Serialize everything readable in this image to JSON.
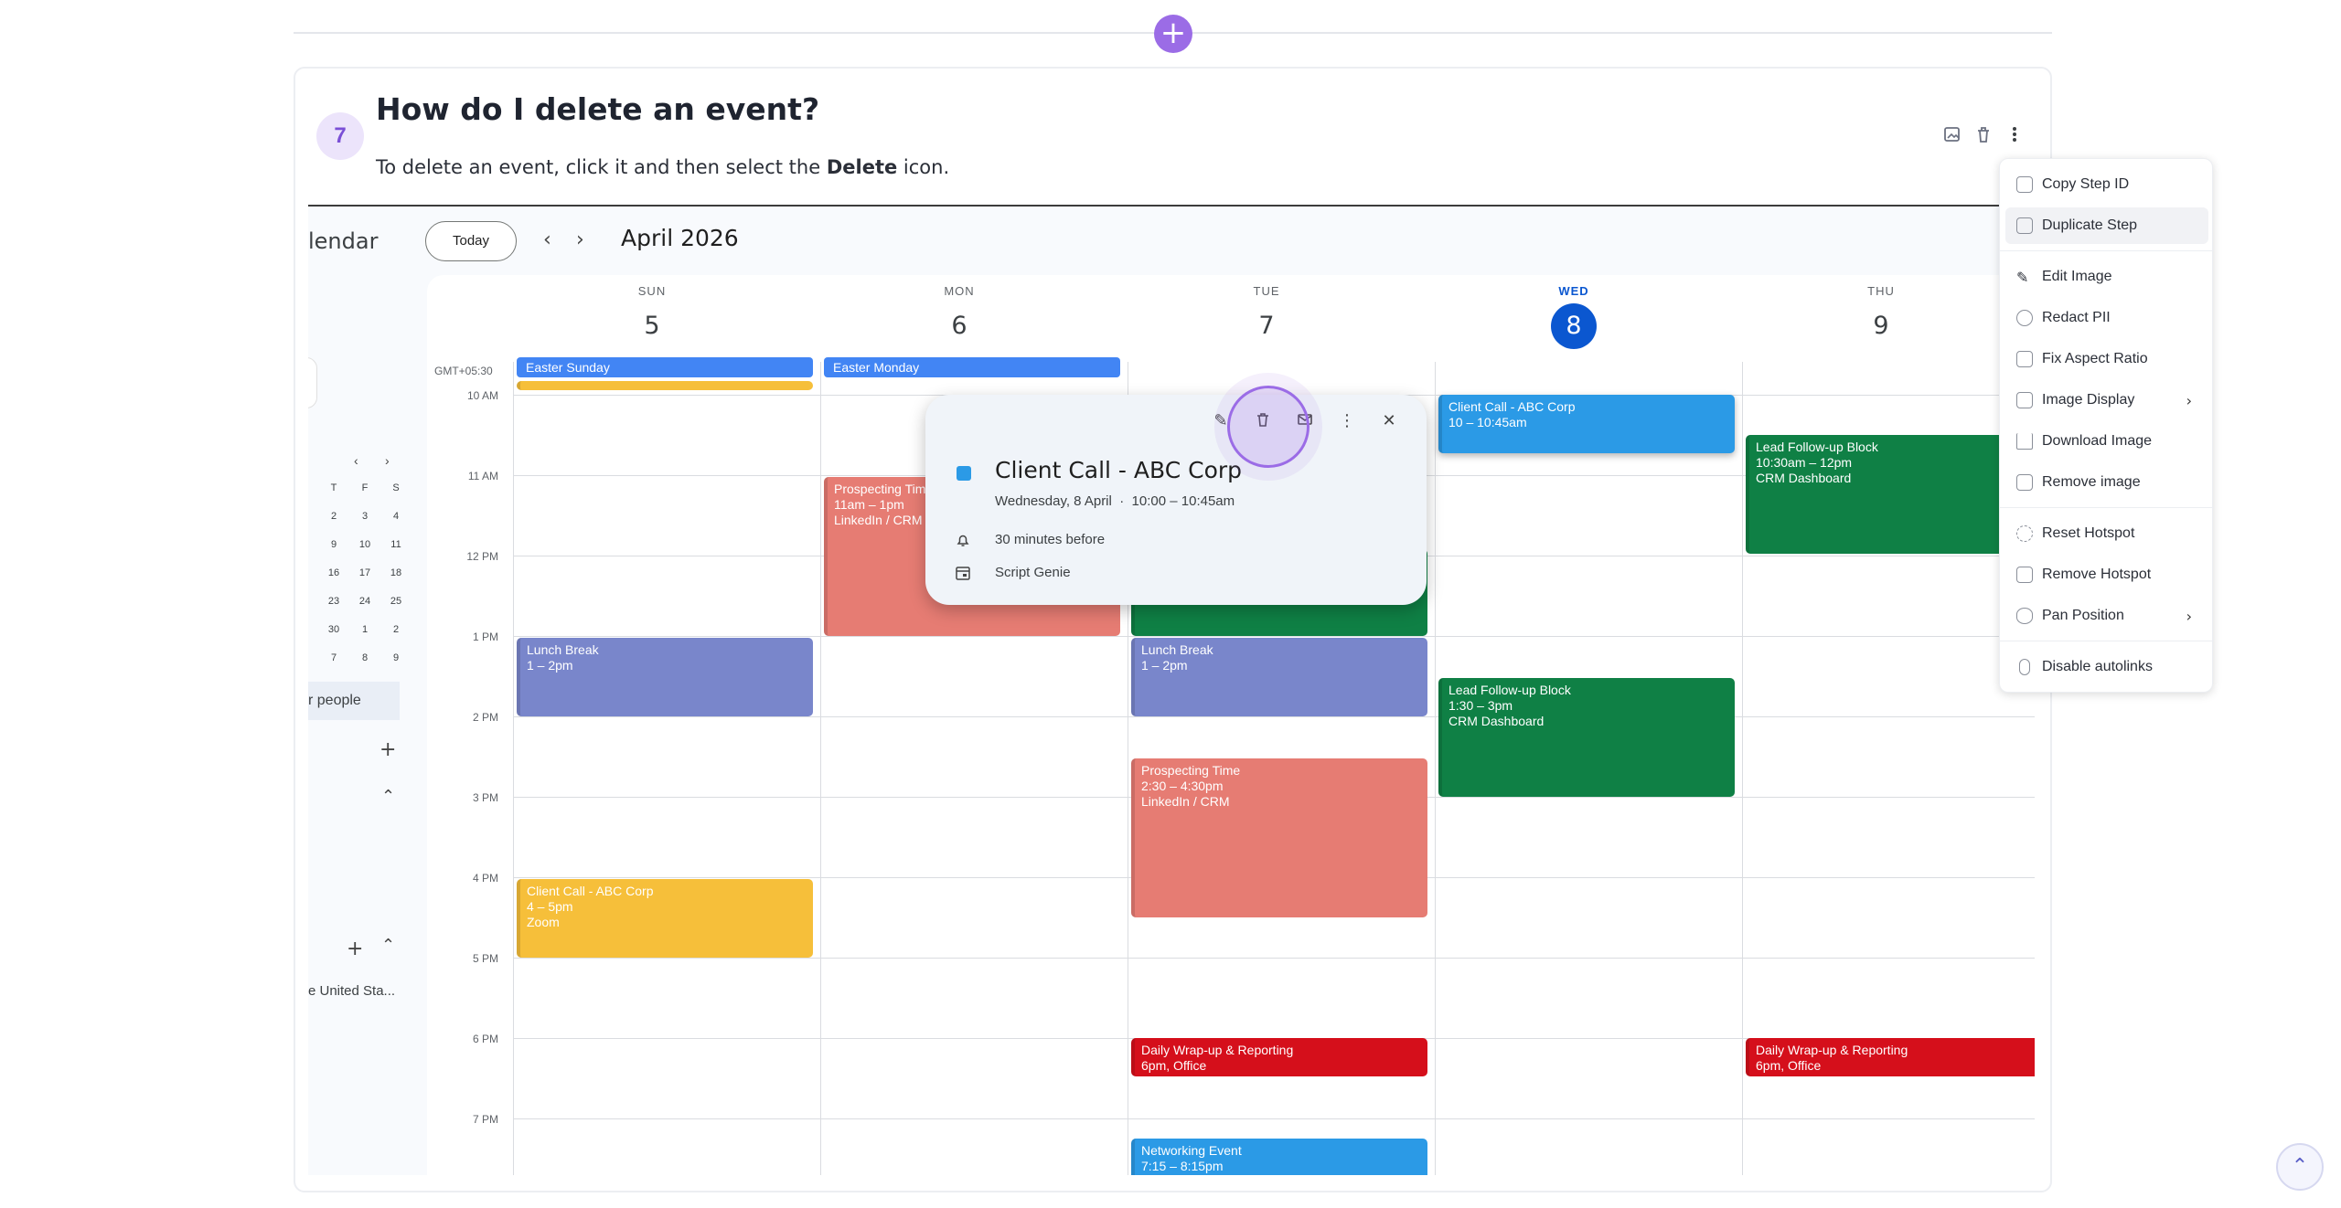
{
  "step": {
    "number": "7",
    "title": "How do I delete an event?",
    "desc_before": "To delete an event, click it and then select the ",
    "desc_bold": "Delete",
    "desc_after": " icon."
  },
  "calendar": {
    "app_title": "lendar",
    "today_label": "Today",
    "prev_icon": "chevron-left-icon",
    "next_icon": "chevron-right-icon",
    "month": "April 2026",
    "timezone": "GMT+05:30",
    "days": [
      {
        "dow": "SUN",
        "num": "5"
      },
      {
        "dow": "MON",
        "num": "6"
      },
      {
        "dow": "TUE",
        "num": "7"
      },
      {
        "dow": "WED",
        "num": "8"
      },
      {
        "dow": "THU",
        "num": "9"
      }
    ],
    "hours": [
      "10 AM",
      "11 AM",
      "12 PM",
      "1 PM",
      "2 PM",
      "3 PM",
      "4 PM",
      "5 PM",
      "6 PM",
      "7 PM"
    ],
    "all_day": [
      "Easter Sunday",
      "Easter Monday"
    ],
    "mini_cal": {
      "headers": [
        "T",
        "F",
        "S"
      ],
      "rows": [
        [
          "2",
          "3",
          "4"
        ],
        [
          "9",
          "10",
          "11"
        ],
        [
          "16",
          "17",
          "18"
        ],
        [
          "23",
          "24",
          "25"
        ],
        [
          "30",
          "1",
          "2"
        ],
        [
          "7",
          "8",
          "9"
        ]
      ]
    },
    "people_label": "r people",
    "holidays_label": "e United Sta...",
    "events": {
      "lunch_sun": {
        "title": "Lunch Break",
        "time": "1 – 2pm"
      },
      "client_sun": {
        "title": "Client Call - ABC Corp",
        "time": "4 – 5pm",
        "place": "Zoom"
      },
      "prospect_mon": {
        "title": "Prospecting Time",
        "time": "11am – 1pm",
        "place": "LinkedIn / CRM"
      },
      "lunch_tue": {
        "title": "Lunch Break",
        "time": "1 – 2pm"
      },
      "prospect_tue": {
        "title": "Prospecting Time",
        "time": "2:30 – 4:30pm",
        "place": "LinkedIn / CRM"
      },
      "wrap_tue": {
        "title": "Daily Wrap-up & Reporting",
        "time": "6pm, Office"
      },
      "network_tue": {
        "title": "Networking Event",
        "time": "7:15 – 8:15pm"
      },
      "client_wed": {
        "title": "Client Call - ABC Corp",
        "time": "10 – 10:45am"
      },
      "lead_wed": {
        "title": "Lead Follow-up Block",
        "time": "1:30 – 3pm",
        "place": "CRM Dashboard"
      },
      "lead_thu": {
        "title": "Lead Follow-up Block",
        "time": "10:30am – 12pm",
        "place": "CRM Dashboard"
      },
      "wrap_thu": {
        "title": "Daily Wrap-up & Reporting",
        "time": "6pm, Office"
      }
    },
    "popup": {
      "title": "Client Call - ABC Corp",
      "date": "Wednesday, 8 April",
      "dot": "·",
      "time": "10:00 – 10:45am",
      "reminder": "30 minutes before",
      "calendar": "Script Genie"
    }
  },
  "menu": {
    "items": [
      {
        "label": "Copy Step ID"
      },
      {
        "label": "Duplicate Step"
      },
      {
        "label": "Edit Image"
      },
      {
        "label": "Redact PII"
      },
      {
        "label": "Fix Aspect Ratio"
      },
      {
        "label": "Image Display"
      },
      {
        "label": "Download Image"
      },
      {
        "label": "Remove image"
      },
      {
        "label": "Reset Hotspot"
      },
      {
        "label": "Remove Hotspot"
      },
      {
        "label": "Pan Position"
      },
      {
        "label": "Disable autolinks"
      }
    ]
  },
  "colors": {
    "accent": "#9b6ce6",
    "event_blue": "#2b9ae6",
    "event_green": "#0f8045",
    "event_red": "#d50f1b"
  }
}
